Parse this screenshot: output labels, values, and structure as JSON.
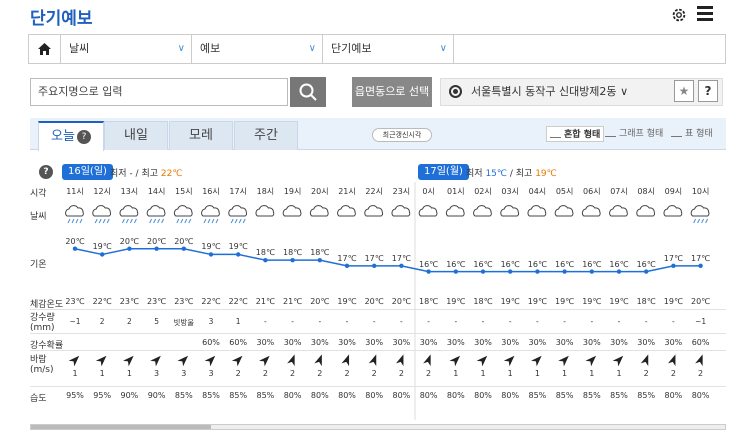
{
  "app": {
    "title": "단기예보"
  },
  "selectors": [
    "날씨",
    "예보",
    "단기예보"
  ],
  "search": {
    "placeholder": "주요지명으로 입력",
    "emd_button": "읍면동으로 선택"
  },
  "location": {
    "name": "서울특별시 동작구 신대방제2동"
  },
  "help_label": "?",
  "star_glyph": "★",
  "tabs": [
    {
      "label": "오늘",
      "active": true
    },
    {
      "label": "내일",
      "active": false
    },
    {
      "label": "모레",
      "active": false
    },
    {
      "label": "주간",
      "active": false
    }
  ],
  "update_button": "최근갱신시각",
  "views": [
    "혼합 형태",
    "그래프 형태",
    "표 형태"
  ],
  "days": [
    {
      "date": "16일(일)",
      "min_label": "최저",
      "min": "-",
      "max_label": "최고",
      "max": "22℃"
    },
    {
      "date": "17일(월)",
      "min_label": "최저",
      "min": "15℃",
      "max_label": "최고",
      "max": "19℃"
    }
  ],
  "row_labels": {
    "time": "시각",
    "weather": "날씨",
    "temp": "기온",
    "feels": "체감온도",
    "precip": "강수량",
    "precip_unit": "(mm)",
    "prob": "강수확률",
    "wind": "바람",
    "wind_unit": "(m/s)",
    "humidity": "습도"
  },
  "hours": [
    "11시",
    "12시",
    "13시",
    "14시",
    "15시",
    "16시",
    "17시",
    "18시",
    "19시",
    "20시",
    "21시",
    "22시",
    "23시",
    "0시",
    "01시",
    "02시",
    "03시",
    "04시",
    "05시",
    "06시",
    "07시",
    "08시",
    "09시",
    "10시"
  ],
  "weather_icons": [
    "rain-cloud",
    "rain-cloud",
    "rain-cloud",
    "rain-cloud",
    "rain-cloud",
    "rain-cloud",
    "rain-cloud",
    "cloud",
    "cloud",
    "cloud",
    "cloud",
    "cloud",
    "cloud",
    "cloud",
    "cloud",
    "cloud",
    "cloud",
    "cloud",
    "cloud",
    "cloud",
    "cloud",
    "cloud",
    "cloud",
    "rain-cloud"
  ],
  "temps": [
    20,
    19,
    20,
    20,
    20,
    19,
    19,
    18,
    18,
    18,
    17,
    17,
    17,
    16,
    16,
    16,
    16,
    16,
    16,
    16,
    16,
    16,
    17,
    17
  ],
  "temp_labels": [
    "20℃",
    "19℃",
    "20℃",
    "20℃",
    "20℃",
    "19℃",
    "19℃",
    "18℃",
    "18℃",
    "18℃",
    "17℃",
    "17℃",
    "17℃",
    "16℃",
    "16℃",
    "16℃",
    "16℃",
    "16℃",
    "16℃",
    "16℃",
    "16℃",
    "16℃",
    "17℃",
    "17℃"
  ],
  "feels": [
    "23℃",
    "22℃",
    "23℃",
    "23℃",
    "23℃",
    "22℃",
    "22℃",
    "21℃",
    "21℃",
    "20℃",
    "19℃",
    "20℃",
    "20℃",
    "18℃",
    "19℃",
    "18℃",
    "19℃",
    "19℃",
    "19℃",
    "19℃",
    "19℃",
    "18℃",
    "19℃",
    "20℃"
  ],
  "precip": [
    "~1",
    "2",
    "2",
    "5",
    "빗방울",
    "3",
    "1",
    "-",
    "-",
    "-",
    "-",
    "-",
    "-",
    "-",
    "-",
    "-",
    "-",
    "-",
    "-",
    "-",
    "-",
    "-",
    "-",
    "~1"
  ],
  "prob": [
    "",
    "",
    "",
    "",
    "",
    "60%",
    "60%",
    "30%",
    "30%",
    "30%",
    "30%",
    "30%",
    "30%",
    "30%",
    "30%",
    "30%",
    "30%",
    "30%",
    "30%",
    "30%",
    "30%",
    "30%",
    "30%",
    "60%"
  ],
  "wind_speed": [
    "1",
    "1",
    "1",
    "3",
    "3",
    "3",
    "2",
    "2",
    "2",
    "2",
    "2",
    "2",
    "2",
    "2",
    "1",
    "1",
    "1",
    "1",
    "1",
    "1",
    "1",
    "2",
    "2",
    "2"
  ],
  "wind_dir_deg": [
    45,
    45,
    45,
    45,
    45,
    45,
    45,
    45,
    20,
    20,
    20,
    20,
    20,
    20,
    45,
    45,
    45,
    45,
    45,
    45,
    45,
    20,
    20,
    20
  ],
  "humidity": [
    "95%",
    "95%",
    "90%",
    "90%",
    "85%",
    "85%",
    "85%",
    "85%",
    "80%",
    "80%",
    "80%",
    "80%",
    "80%",
    "80%",
    "80%",
    "80%",
    "80%",
    "85%",
    "85%",
    "85%",
    "85%",
    "85%",
    "80%",
    "80%"
  ]
}
